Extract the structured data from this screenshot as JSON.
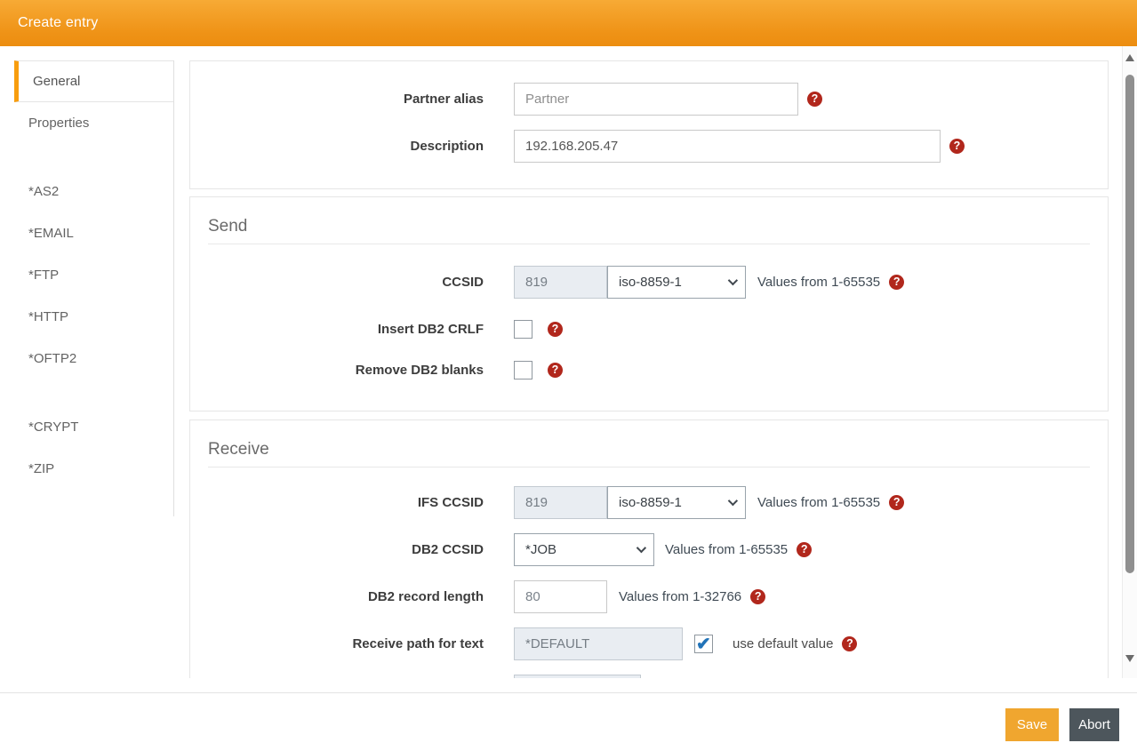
{
  "header": {
    "title": "Create entry"
  },
  "sidebar": {
    "items": [
      {
        "label": "General",
        "active": true
      },
      {
        "label": "Properties",
        "active": false
      },
      {
        "label": "*AS2",
        "active": false
      },
      {
        "label": "*EMAIL",
        "active": false
      },
      {
        "label": "*FTP",
        "active": false
      },
      {
        "label": "*HTTP",
        "active": false
      },
      {
        "label": "*OFTP2",
        "active": false
      },
      {
        "label": "*CRYPT",
        "active": false
      },
      {
        "label": "*ZIP",
        "active": false
      }
    ]
  },
  "general": {
    "partner_alias": {
      "label": "Partner alias",
      "placeholder": "Partner",
      "value": ""
    },
    "description": {
      "label": "Description",
      "value": "192.168.205.47"
    }
  },
  "send": {
    "title": "Send",
    "ccsid": {
      "label": "CCSID",
      "value": "819",
      "encoding": "iso-8859-1",
      "hint": "Values from 1-65535"
    },
    "insert_db2_crlf": {
      "label": "Insert DB2 CRLF",
      "checked": false
    },
    "remove_db2_blanks": {
      "label": "Remove DB2 blanks",
      "checked": false
    }
  },
  "receive": {
    "title": "Receive",
    "ifs_ccsid": {
      "label": "IFS CCSID",
      "value": "819",
      "encoding": "iso-8859-1",
      "hint": "Values from 1-65535"
    },
    "db2_ccsid": {
      "label": "DB2 CCSID",
      "value": "*JOB",
      "hint": "Values from 1-65535"
    },
    "db2_record_length": {
      "label": "DB2 record length",
      "value": "80",
      "hint": "Values from 1-32766"
    },
    "receive_path_text": {
      "label": "Receive path for text",
      "value": "*DEFAULT",
      "checkbox_label": "use default value",
      "checked": true
    },
    "partial_row": {
      "value": "",
      "checked": false
    }
  },
  "footer": {
    "save": "Save",
    "abort": "Abort"
  },
  "colors": {
    "header_orange_top": "#f7aa35",
    "header_orange_bottom": "#ec8d10",
    "accent_orange": "#f89d0e",
    "save_orange": "#f0a62f",
    "abort_gray": "#4d565c",
    "help_red": "#b1271c",
    "check_blue": "#2173b8",
    "disabled_bg": "#e9edf2"
  }
}
